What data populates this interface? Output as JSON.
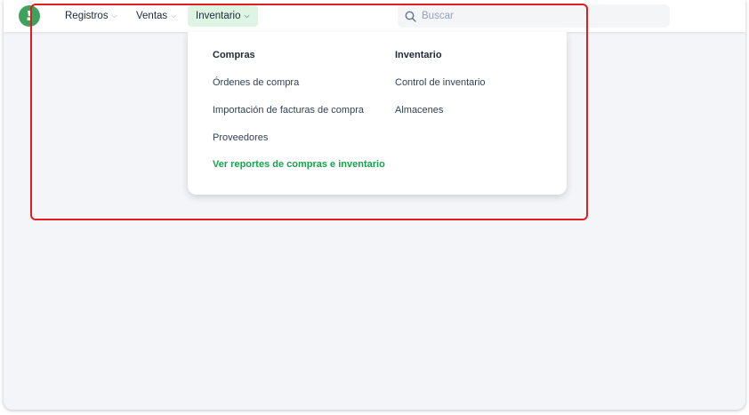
{
  "nav": {
    "items": [
      {
        "label": "Registros"
      },
      {
        "label": "Ventas"
      },
      {
        "label": "Inventario",
        "active": true
      }
    ]
  },
  "search": {
    "placeholder": "Buscar"
  },
  "dropdown": {
    "columns": [
      {
        "heading": "Compras",
        "items": [
          "Órdenes de compra",
          "Importación de facturas de compra",
          "Proveedores"
        ],
        "report_link": "Ver reportes de compras e inventario"
      },
      {
        "heading": "Inventario",
        "items": [
          "Control de inventario",
          "Almacenes"
        ]
      }
    ]
  },
  "colors": {
    "brand": "#3fa15e",
    "active_nav_bg": "#dff5e3",
    "link_green": "#16a34a",
    "highlight_border": "#e11d1d"
  }
}
